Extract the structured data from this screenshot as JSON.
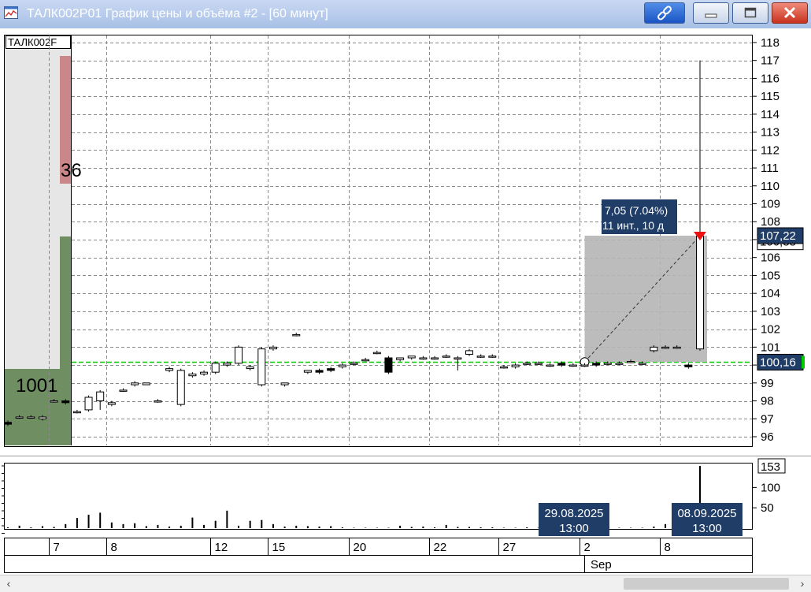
{
  "window": {
    "title": "ТАЛК002Р01 График цены и объёма #2 - [60 минут]",
    "buttons": [
      "link",
      "minimize",
      "maximize",
      "close"
    ]
  },
  "price_chart": {
    "ticker_label": "ТАЛК002F",
    "sell_count": "36",
    "buy_count": "1001",
    "y_ticks": [
      "96",
      "97",
      "98",
      "99",
      "100",
      "101",
      "102",
      "103",
      "104",
      "105",
      "106",
      "107",
      "108",
      "109",
      "110",
      "111",
      "112",
      "113",
      "114",
      "115",
      "116",
      "117",
      "118"
    ],
    "last_price_label": "107,22",
    "hidden_price_label": "106,88",
    "level_price_label": "100,16",
    "measure_line1": "7,05 (7.04%)",
    "measure_line2": "11 инт., 10 д",
    "colors": {
      "sell": "#c9878a",
      "buy": "#6f8f63",
      "level": "#00cc00",
      "marker": "#ee1111",
      "label_bg": "#1f3d66"
    }
  },
  "volume_chart": {
    "y_ticks": [
      "50",
      "100"
    ],
    "top_label": "153",
    "date_label_left": [
      "29.08.2025",
      "13:00"
    ],
    "date_label_right": [
      "08.09.2025",
      "13:00"
    ]
  },
  "time_axis": {
    "day_labels": [
      "7",
      "8",
      "12",
      "15",
      "20",
      "22",
      "27",
      "2",
      "8"
    ],
    "month_label": "Sep"
  },
  "scrollbar": {
    "left_arrow": "‹",
    "right_arrow": "›"
  },
  "chart_data": {
    "type": "candlestick",
    "x_unit": "hourly bar index",
    "ylim": [
      96,
      118
    ],
    "volume_ylim": [
      0,
      153
    ],
    "candles": [
      [
        0,
        96.8,
        96.7,
        96.9,
        96.6
      ],
      [
        1,
        97.1,
        97.1,
        97.2,
        97.0
      ],
      [
        2,
        97.1,
        97.1,
        97.2,
        97.0
      ],
      [
        3,
        97.0,
        97.1,
        97.2,
        96.9
      ],
      [
        4,
        98.0,
        98.0,
        98.1,
        97.9
      ],
      [
        5,
        98.0,
        97.9,
        98.1,
        97.8
      ],
      [
        6,
        97.4,
        97.4,
        97.5,
        97.3
      ],
      [
        7,
        97.5,
        98.2,
        98.3,
        97.4
      ],
      [
        8,
        98.0,
        98.5,
        98.6,
        97.5
      ],
      [
        9,
        97.8,
        97.9,
        98.0,
        97.7
      ],
      [
        10,
        98.6,
        98.6,
        98.7,
        98.5
      ],
      [
        11,
        98.9,
        99.0,
        99.1,
        98.8
      ],
      [
        12,
        98.9,
        99.0,
        99.0,
        98.9
      ],
      [
        13,
        98.0,
        98.0,
        98.1,
        97.9
      ],
      [
        14,
        99.7,
        99.8,
        99.9,
        99.6
      ],
      [
        15,
        97.8,
        99.7,
        99.8,
        97.7
      ],
      [
        16,
        99.4,
        99.5,
        99.6,
        99.3
      ],
      [
        17,
        99.5,
        99.6,
        99.7,
        99.4
      ],
      [
        18,
        99.6,
        100.1,
        100.2,
        99.5
      ],
      [
        19,
        100.0,
        100.1,
        100.2,
        99.9
      ],
      [
        20,
        100.1,
        101.0,
        101.1,
        100.0
      ],
      [
        21,
        99.8,
        99.9,
        100.0,
        99.7
      ],
      [
        22,
        98.9,
        100.9,
        101.0,
        98.8
      ],
      [
        23,
        100.9,
        101.0,
        101.1,
        100.8
      ],
      [
        24,
        98.9,
        99.0,
        99.0,
        98.8
      ],
      [
        25,
        101.7,
        101.7,
        101.8,
        101.6
      ],
      [
        26,
        99.6,
        99.7,
        99.7,
        99.5
      ],
      [
        27,
        99.7,
        99.6,
        99.8,
        99.5
      ],
      [
        28,
        99.8,
        99.7,
        99.9,
        99.6
      ],
      [
        29,
        99.9,
        100.0,
        100.1,
        99.8
      ],
      [
        30,
        100.1,
        100.1,
        100.2,
        100.0
      ],
      [
        31,
        100.3,
        100.3,
        100.4,
        100.2
      ],
      [
        32,
        100.7,
        100.7,
        100.8,
        100.6
      ],
      [
        33,
        100.4,
        99.6,
        100.5,
        99.5
      ],
      [
        34,
        100.3,
        100.4,
        100.4,
        100.2
      ],
      [
        35,
        100.4,
        100.5,
        100.5,
        100.3
      ],
      [
        36,
        100.4,
        100.4,
        100.5,
        100.3
      ],
      [
        37,
        100.4,
        100.4,
        100.5,
        100.3
      ],
      [
        38,
        100.5,
        100.5,
        100.6,
        100.4
      ],
      [
        39,
        100.4,
        100.4,
        100.5,
        99.7
      ],
      [
        40,
        100.6,
        100.8,
        100.9,
        100.5
      ],
      [
        41,
        100.5,
        100.5,
        100.6,
        100.4
      ],
      [
        42,
        100.5,
        100.5,
        100.6,
        100.4
      ],
      [
        43,
        99.9,
        99.9,
        100.0,
        99.8
      ],
      [
        44,
        99.9,
        100.0,
        100.1,
        99.8
      ],
      [
        45,
        100.1,
        100.1,
        100.2,
        100.0
      ],
      [
        46,
        100.1,
        100.1,
        100.2,
        100.0
      ],
      [
        47,
        100.0,
        100.0,
        100.1,
        99.9
      ],
      [
        48,
        100.1,
        100.0,
        100.2,
        99.9
      ],
      [
        49,
        100.0,
        100.0,
        100.1,
        99.9
      ],
      [
        50,
        100.0,
        100.0,
        100.1,
        99.9
      ],
      [
        51,
        100.1,
        100.0,
        100.2,
        99.9
      ],
      [
        52,
        100.1,
        100.1,
        100.2,
        100.0
      ],
      [
        53,
        100.1,
        100.1,
        100.2,
        100.0
      ],
      [
        54,
        100.2,
        100.2,
        100.3,
        100.1
      ],
      [
        55,
        100.1,
        100.1,
        100.2,
        100.0
      ],
      [
        56,
        100.8,
        101.0,
        101.1,
        100.7
      ],
      [
        57,
        101.0,
        101.0,
        101.1,
        100.9
      ],
      [
        58,
        101.0,
        101.0,
        101.1,
        100.9
      ],
      [
        59,
        100.0,
        99.9,
        100.1,
        99.8
      ],
      [
        60,
        100.9,
        107.2,
        117.0,
        100.8
      ]
    ],
    "volumes": [
      2,
      6,
      2,
      5,
      3,
      10,
      25,
      33,
      38,
      14,
      10,
      12,
      5,
      8,
      4,
      6,
      26,
      8,
      18,
      43,
      6,
      18,
      20,
      10,
      4,
      6,
      5,
      4,
      5,
      2,
      1,
      1,
      1,
      1,
      6,
      3,
      4,
      2,
      8,
      3,
      3,
      2,
      2,
      1,
      1,
      2,
      1,
      1,
      1,
      1,
      1,
      2,
      1,
      1,
      1,
      1,
      4,
      10,
      2,
      4,
      153
    ],
    "day_boundaries": [
      4,
      9,
      18,
      23,
      30,
      37,
      43,
      50,
      57
    ],
    "level_price": 100.16,
    "last_price": 107.22,
    "measure": {
      "from_bar": 50,
      "to_bar": 60,
      "from_price": 100.17,
      "to_price": 107.22
    }
  }
}
